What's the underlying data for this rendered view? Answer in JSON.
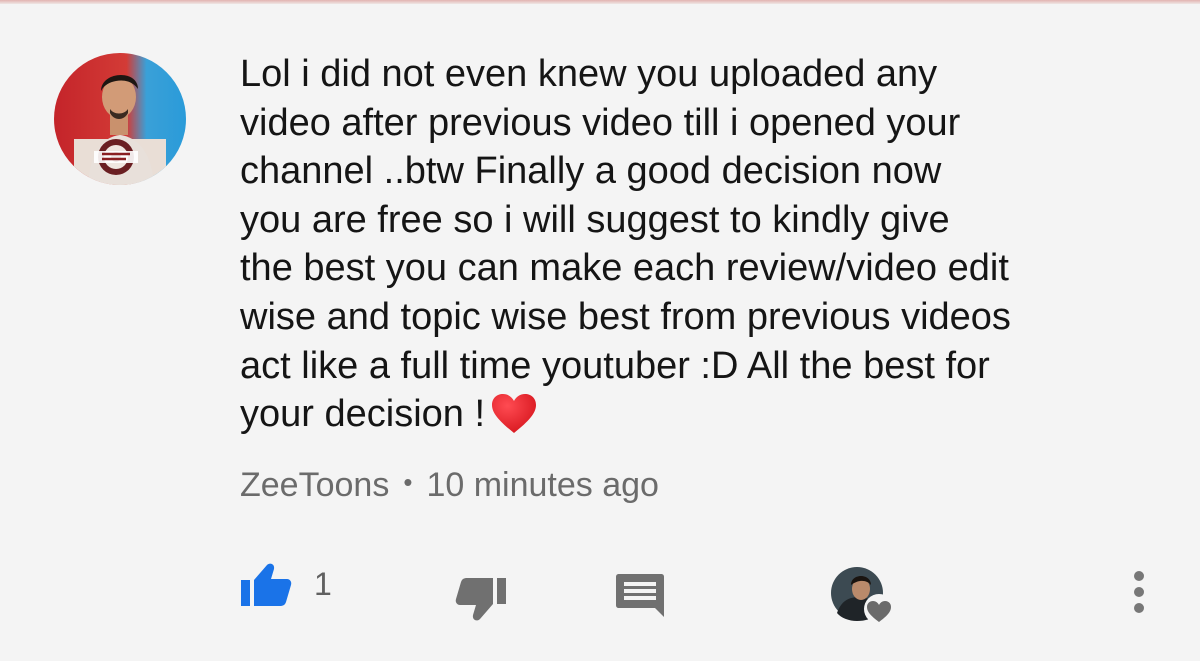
{
  "comment": {
    "text": "Lol i did not even knew you uploaded any\nvideo after previous video till i opened your\nchannel ..btw Finally a good decision now\nyou are free so i will suggest to kindly give\nthe best you can make each review/video edit\nwise and topic wise best from previous videos\nact like a full time youtuber :D All the best for\nyour decision !",
    "emoji": "red-heart-icon",
    "author": "ZeeToons",
    "separator": "•",
    "timestamp": "10 minutes ago",
    "like_count": "1",
    "liked": true
  },
  "actions": {
    "like_icon": "thumbs-up-icon",
    "dislike_icon": "thumbs-down-icon",
    "reply_icon": "reply-comment-icon",
    "creator_heart_icon": "creator-heart-avatar-icon",
    "more_icon": "more-vert-icon"
  },
  "colors": {
    "background": "#f4f4f4",
    "text": "#151515",
    "meta": "#6b6b6b",
    "like_active": "#1a73e8",
    "icon_gray": "#707070",
    "heart_red": "#e0242b"
  }
}
